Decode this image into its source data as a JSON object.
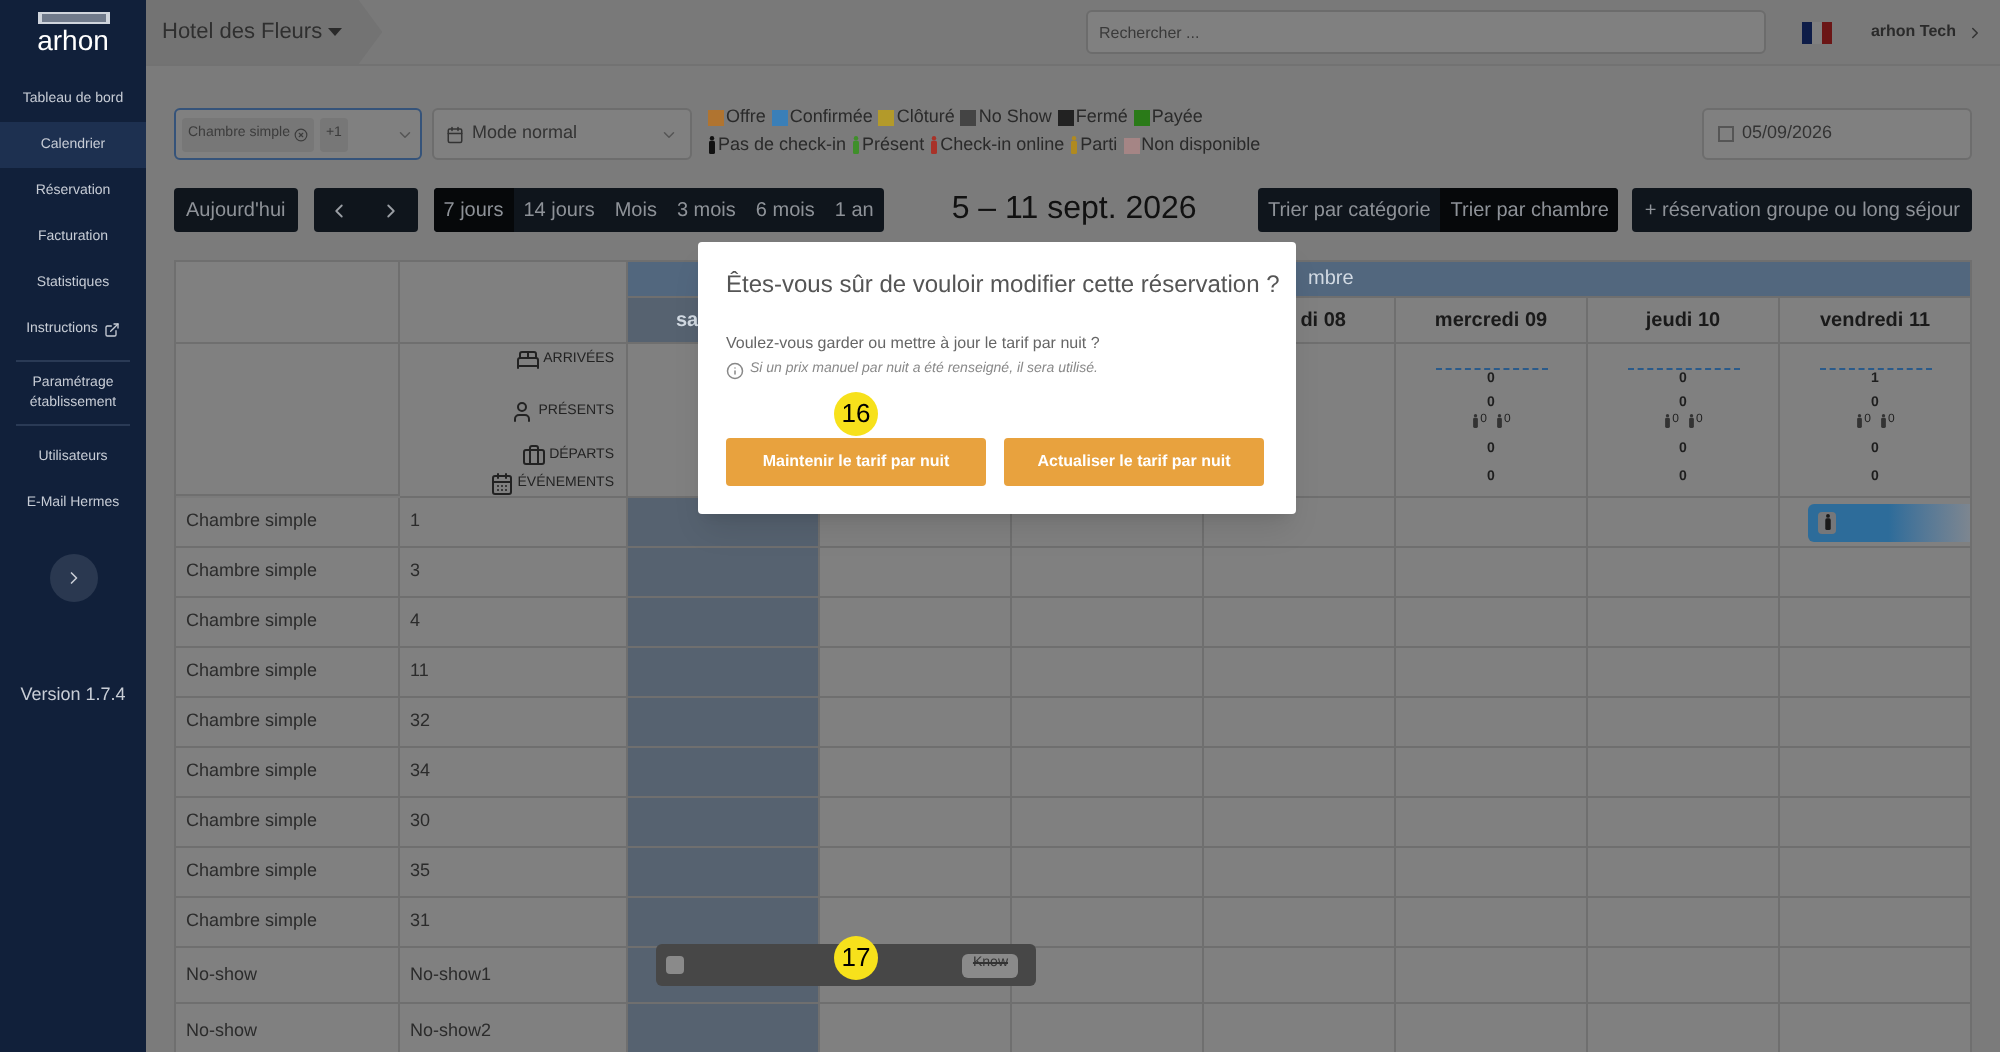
{
  "sidebar": {
    "logo": "arhon",
    "groups": [
      [
        {
          "label": "Tableau de bord",
          "selected": false,
          "external": false
        },
        {
          "label": "Calendrier",
          "selected": true,
          "external": false
        },
        {
          "label": "Réservation",
          "selected": false,
          "external": false
        },
        {
          "label": "Facturation",
          "selected": false,
          "external": false
        },
        {
          "label": "Statistiques",
          "selected": false,
          "external": false
        },
        {
          "label": "Instructions",
          "selected": false,
          "external": true
        }
      ],
      [
        {
          "label": "Paramétrage établissement",
          "selected": false,
          "external": false
        }
      ],
      [
        {
          "label": "Utilisateurs",
          "selected": false,
          "external": false
        },
        {
          "label": "E-Mail Hermes",
          "selected": false,
          "external": false
        }
      ]
    ],
    "version": "Version 1.7.4"
  },
  "topbar": {
    "hotel": "Hotel des Fleurs",
    "search_placeholder": "Rechercher ...",
    "user": "arhon Tech"
  },
  "filters": {
    "room_type_chip": "Chambre simple",
    "more_chip": "+1",
    "mode": "Mode normal",
    "date": "05/09/2026"
  },
  "legend": [
    [
      {
        "label": "Offre",
        "kind": "square",
        "color": "#b07430"
      },
      {
        "label": "Confirmée",
        "kind": "square",
        "color": "#3a7fb8"
      },
      {
        "label": "Clôturé",
        "kind": "square",
        "color": "#b39a2a"
      },
      {
        "label": "No Show",
        "kind": "square",
        "color": "#444444"
      },
      {
        "label": "Fermé",
        "kind": "square",
        "color": "#222222"
      },
      {
        "label": "Payée",
        "kind": "square",
        "color": "#2a7a18"
      }
    ],
    [
      {
        "label": "Pas de check-in",
        "kind": "person",
        "color": "#111111"
      },
      {
        "label": "Présent",
        "kind": "person",
        "color": "#3f8f2a"
      },
      {
        "label": "Check-in online",
        "kind": "person",
        "color": "#a83228"
      },
      {
        "label": "Parti",
        "kind": "person",
        "color": "#b08a20"
      },
      {
        "label": "Non disponible",
        "kind": "square",
        "color": "#a58585"
      }
    ]
  ],
  "toolbar": {
    "today": "Aujourd'hui",
    "ranges": [
      {
        "label": "7 jours",
        "selected": true
      },
      {
        "label": "14 jours",
        "selected": false
      },
      {
        "label": "Mois",
        "selected": false
      },
      {
        "label": "3 mois",
        "selected": false
      },
      {
        "label": "6 mois",
        "selected": false
      },
      {
        "label": "1 an",
        "selected": false
      }
    ],
    "period": "5 – 11 sept. 2026",
    "sorts": [
      {
        "label": "Trier par catégorie",
        "selected": false
      },
      {
        "label": "Trier par chambre",
        "selected": true
      }
    ],
    "group_button": "+ réservation groupe ou long séjour"
  },
  "calendar": {
    "month": "mbre",
    "stat_labels": [
      {
        "label": "ARRIVÉES",
        "kind": "bed"
      },
      {
        "label": "PRÉSENTS",
        "kind": "person"
      },
      {
        "label": "DÉPARTS",
        "kind": "suitcase"
      },
      {
        "label": "ÉVÉNEMENTS",
        "kind": "calendar"
      }
    ],
    "days": [
      {
        "label": "sa",
        "highlighted": true
      },
      {
        "highlighted": false
      },
      {
        "highlighted": false
      },
      {
        "label": "di 08",
        "highlighted": false
      },
      {
        "label": "mercredi 09",
        "highlighted": false,
        "stats": {
          "arrivals": "0",
          "present": "0",
          "present_in": "0",
          "present_out": "0",
          "departures": "0",
          "events": "0"
        }
      },
      {
        "label": "jeudi 10",
        "highlighted": false,
        "stats": {
          "arrivals": "0",
          "present": "0",
          "present_in": "0",
          "present_out": "0",
          "departures": "0",
          "events": "0"
        }
      },
      {
        "label": "vendredi 11",
        "highlighted": false,
        "stats": {
          "arrivals": "1",
          "present": "0",
          "present_in": "0",
          "present_out": "0",
          "departures": "0",
          "events": "0"
        }
      }
    ],
    "rows": [
      {
        "category": "Chambre simple",
        "room": "1",
        "has_booking": true
      },
      {
        "category": "Chambre simple",
        "room": "3",
        "has_booking": false
      },
      {
        "category": "Chambre simple",
        "room": "4",
        "has_booking": false
      },
      {
        "category": "Chambre simple",
        "room": "11",
        "has_booking": false
      },
      {
        "category": "Chambre simple",
        "room": "32",
        "has_booking": false
      },
      {
        "category": "Chambre simple",
        "room": "34",
        "has_booking": false
      },
      {
        "category": "Chambre simple",
        "room": "30",
        "has_booking": false
      },
      {
        "category": "Chambre simple",
        "room": "35",
        "has_booking": false
      },
      {
        "category": "Chambre simple",
        "room": "31",
        "has_booking": false
      },
      {
        "category": "No-show",
        "room": "No-show1",
        "has_booking": false
      },
      {
        "category": "No-show",
        "room": "No-show2",
        "has_booking": false
      }
    ]
  },
  "modal": {
    "title": "Êtes-vous sûr de vouloir modifier cette réservation ?",
    "question": "Voulez-vous garder ou mettre à jour le tarif par nuit ?",
    "note": "Si un prix manuel par nuit a été renseigné, il sera utilisé.",
    "buttons": [
      "Maintenir le tarif par nuit",
      "Actualiser le tarif par nuit"
    ]
  },
  "toast": {
    "checked": false,
    "button": "Know"
  },
  "markers": [
    "16",
    "17"
  ]
}
